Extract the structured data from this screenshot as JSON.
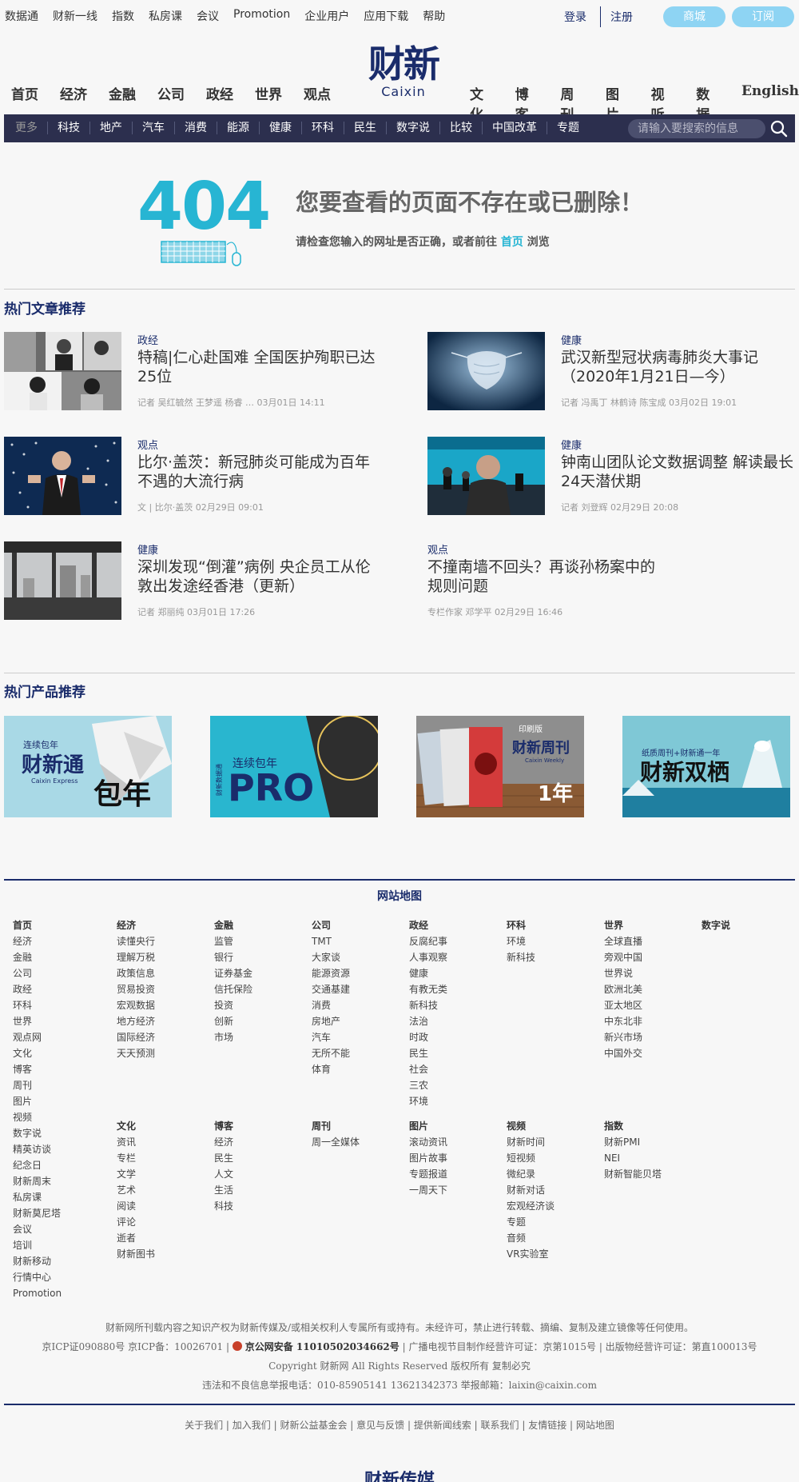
{
  "topbar": {
    "links": [
      "数据通",
      "财新一线",
      "指数",
      "私房课",
      "会议",
      "Promotion",
      "企业用户",
      "应用下载",
      "帮助"
    ],
    "login": "登录",
    "register": "注册",
    "shop": "商城",
    "subscribe": "订阅"
  },
  "logo": {
    "cn": "财新",
    "en": "Caixin"
  },
  "mainnav": {
    "left": [
      "首页",
      "经济",
      "金融",
      "公司",
      "政经",
      "世界",
      "观点"
    ],
    "right": [
      "文化",
      "博客",
      "周刊",
      "图片",
      "视听",
      "数据",
      "English"
    ]
  },
  "subnav": {
    "items": [
      "更多",
      "科技",
      "地产",
      "汽车",
      "消费",
      "能源",
      "健康",
      "环科",
      "民生",
      "数字说",
      "比较",
      "中国改革",
      "专题"
    ],
    "search_placeholder": "请输入要搜索的信息"
  },
  "error": {
    "code": "404",
    "title": "您要查看的页面不存在或已删除！",
    "desc_before": "请检查您输入的网址是否正确，或者前往",
    "desc_link": "首页",
    "desc_after": "浏览"
  },
  "hot_articles": {
    "title": "热门文章推荐",
    "items": [
      {
        "category": "政经",
        "title": "特稿|仁心赴国难 全国医护殉职已达25位",
        "meta": "记者 吴红毓然 王梦遥 杨睿 …    03月01日 14:11"
      },
      {
        "category": "健康",
        "title": "武汉新型冠状病毒肺炎大事记（2020年1月21日—今）",
        "meta": "记者 冯禹丁 林鹤诗 陈宝成 03月02日 19:01"
      },
      {
        "category": "观点",
        "title": "比尔·盖茨：新冠肺炎可能成为百年不遇的大流行病",
        "meta": "文 | 比尔·盖茨 02月29日 09:01"
      },
      {
        "category": "健康",
        "title": "钟南山团队论文数据调整 解读最长24天潜伏期",
        "meta": "记者 刘登辉 02月29日 20:08"
      },
      {
        "category": "健康",
        "title": "深圳发现“倒灌”病例 央企员工从伦敦出发途经香港（更新）",
        "meta": "记者 郑丽纯 03月01日 17:26"
      },
      {
        "category": "观点",
        "title": "不撞南墙不回头？再谈孙杨案中的规则问题",
        "meta": "专栏作家 邓学平 02月29日 16:46"
      }
    ]
  },
  "hot_products": {
    "title": "热门产品推荐",
    "items": [
      {
        "top": "连续包年",
        "main": "财新通",
        "sub": "Caixin Express",
        "badge": "包年"
      },
      {
        "top": "连续包年",
        "main": "PRO",
        "side": "财新数据通"
      },
      {
        "top": "印刷版",
        "main": "财新周刊",
        "sub": "Caixin Weekly",
        "badge": "1年"
      },
      {
        "top": "纸质周刊+财新通一年",
        "main": "财新双栖"
      }
    ]
  },
  "sitemap": {
    "title": "网站地图",
    "columns_top": [
      {
        "head": "首页",
        "items": [
          "经济",
          "金融",
          "公司",
          "政经",
          "环科",
          "世界",
          "观点网",
          "文化",
          "博客",
          "周刊",
          "图片",
          "视频",
          "数字说",
          "精英访谈",
          "纪念日",
          "财新周末",
          "私房课",
          "财新莫尼塔",
          "会议",
          "培训",
          "财新移动",
          "行情中心",
          "Promotion"
        ]
      },
      {
        "head": "经济",
        "items": [
          "读懂央行",
          "理解万税",
          "政策信息",
          "贸易投资",
          "宏观数据",
          "地方经济",
          "国际经济",
          "天天预测"
        ]
      },
      {
        "head": "金融",
        "items": [
          "监管",
          "银行",
          "证券基金",
          "信托保险",
          "投资",
          "创新",
          "市场"
        ]
      },
      {
        "head": "公司",
        "items": [
          "TMT",
          "大家谈",
          "能源资源",
          "交通基建",
          "消费",
          "房地产",
          "汽车",
          "无所不能",
          "体育"
        ]
      },
      {
        "head": "政经",
        "items": [
          "反腐纪事",
          "人事观察",
          "健康",
          "有教无类",
          "新科技",
          "法治",
          "时政",
          "民生",
          "社会",
          "三农",
          "环境"
        ]
      },
      {
        "head": "环科",
        "items": [
          "环境",
          "新科技"
        ]
      },
      {
        "head": "世界",
        "items": [
          "全球直播",
          "旁观中国",
          "世界说",
          "欧洲北美",
          "亚太地区",
          "中东北非",
          "新兴市场",
          "中国外交"
        ]
      },
      {
        "head": "数字说",
        "items": []
      }
    ],
    "columns_bottom": [
      {
        "head": "文化",
        "items": [
          "资讯",
          "专栏",
          "文学",
          "艺术",
          "阅读",
          "评论",
          "逝者",
          "财新图书"
        ]
      },
      {
        "head": "博客",
        "items": [
          "经济",
          "民生",
          "人文",
          "生活",
          "科技"
        ]
      },
      {
        "head": "周刊",
        "items": [
          "周一全媒体"
        ]
      },
      {
        "head": "图片",
        "items": [
          "滚动资讯",
          "图片故事",
          "专题报道",
          "一周天下"
        ]
      },
      {
        "head": "视频",
        "items": [
          "财新时间",
          "短视频",
          "微纪录",
          "财新对话",
          "宏观经济谈",
          "专题",
          "音频",
          "VR实验室"
        ]
      },
      {
        "head": "指数",
        "items": [
          "财新PMI",
          "NEI",
          "财新智能贝塔"
        ]
      }
    ]
  },
  "footer": {
    "copyright_note": "财新网所刊载内容之知识产权为财新传媒及/或相关权利人专属所有或持有。未经许可，禁止进行转载、摘编、复制及建立镜像等任何使用。",
    "icp": "京ICP证090880号 京ICP备：10026701 |",
    "police": "京公网安备 11010502034662号",
    "license": "| 广播电视节目制作经营许可证：京第1015号 | 出版物经营许可证：第直100013号",
    "rights": "Copyright 财新网 All Rights Reserved 版权所有 复制必究",
    "report": "违法和不良信息举报电话：010-85905141    13621342373 举报邮箱：laixin@caixin.com",
    "links": [
      "关于我们",
      "加入我们",
      "财新公益基金会",
      "意见与反馈",
      "提供新闻线索",
      "联系我们",
      "友情链接",
      "网站地图"
    ],
    "brand": "财新传媒"
  }
}
